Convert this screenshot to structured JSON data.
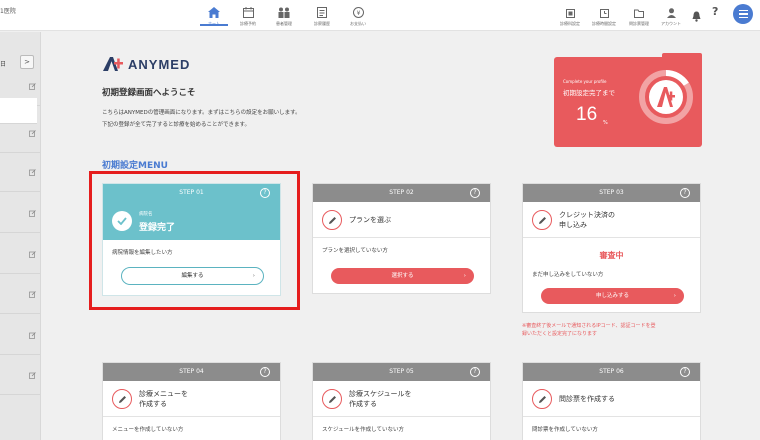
{
  "header": {
    "clinic_name": "1医院",
    "nav": [
      {
        "label": "ホーム",
        "icon": "home-icon",
        "active": true
      },
      {
        "label": "診療予約",
        "icon": "calendar-icon"
      },
      {
        "label": "患者管理",
        "icon": "patients-icon"
      },
      {
        "label": "診察履歴",
        "icon": "history-icon"
      },
      {
        "label": "お支払い",
        "icon": "payment-icon"
      }
    ],
    "right_nav": [
      {
        "label": "診療科設定",
        "icon": "department-icon"
      },
      {
        "label": "診療時間設定",
        "icon": "clock-icon"
      },
      {
        "label": "問診票管理",
        "icon": "folder-icon"
      },
      {
        "label": "アカウント",
        "icon": "account-icon"
      }
    ],
    "help_label": "?"
  },
  "sidebar": {
    "date_label": "日",
    "arrow_label": ">"
  },
  "main": {
    "logo_text": "ANYMED",
    "welcome": "初期登録画面へようこそ",
    "intro_line1": "こちらはANYMEDの管理画面になります。まずはこちらの設定をお願いします。",
    "intro_line2": "下記の登録が全て完了すると診療を始めることができます。",
    "menu_title": "初期設定MENU"
  },
  "progress": {
    "small": "Complete your profile",
    "label": "初期設定完了まで",
    "value": "16",
    "unit": "%",
    "percent": 16,
    "color": "#e85a5d"
  },
  "steps": [
    {
      "step": "STEP 01",
      "subtitle": "病院名",
      "title": "登録完了",
      "desc": "病院情報を編集したい方",
      "button": "編集する",
      "done": true
    },
    {
      "step": "STEP 02",
      "title": "プランを選ぶ",
      "desc": "プランを選択していない方",
      "button": "選択する"
    },
    {
      "step": "STEP 03",
      "title1": "クレジット決済の",
      "title2": "申し込み",
      "status": "審査中",
      "desc": "まだ申し込みをしていない方",
      "button": "申し込みする",
      "note1": "※審査終了後メールで通知されるIPコード、認証コードを登",
      "note2": "録いただくと設定完了になります"
    },
    {
      "step": "STEP 04",
      "title1": "診療メニューを",
      "title2": "作成する",
      "desc": "メニューを作成していない方"
    },
    {
      "step": "STEP 05",
      "title1": "診療スケジュールを",
      "title2": "作成する",
      "desc": "スケジュールを作成していない方"
    },
    {
      "step": "STEP 06",
      "title": "問診票を作成する",
      "desc": "問診票を作成していない方"
    }
  ],
  "colors": {
    "accent": "#4a7bd1",
    "teal": "#6cc1cb",
    "red": "#e85a5d",
    "gray_header": "#8c8c8c",
    "highlight": "#e51d1d"
  }
}
